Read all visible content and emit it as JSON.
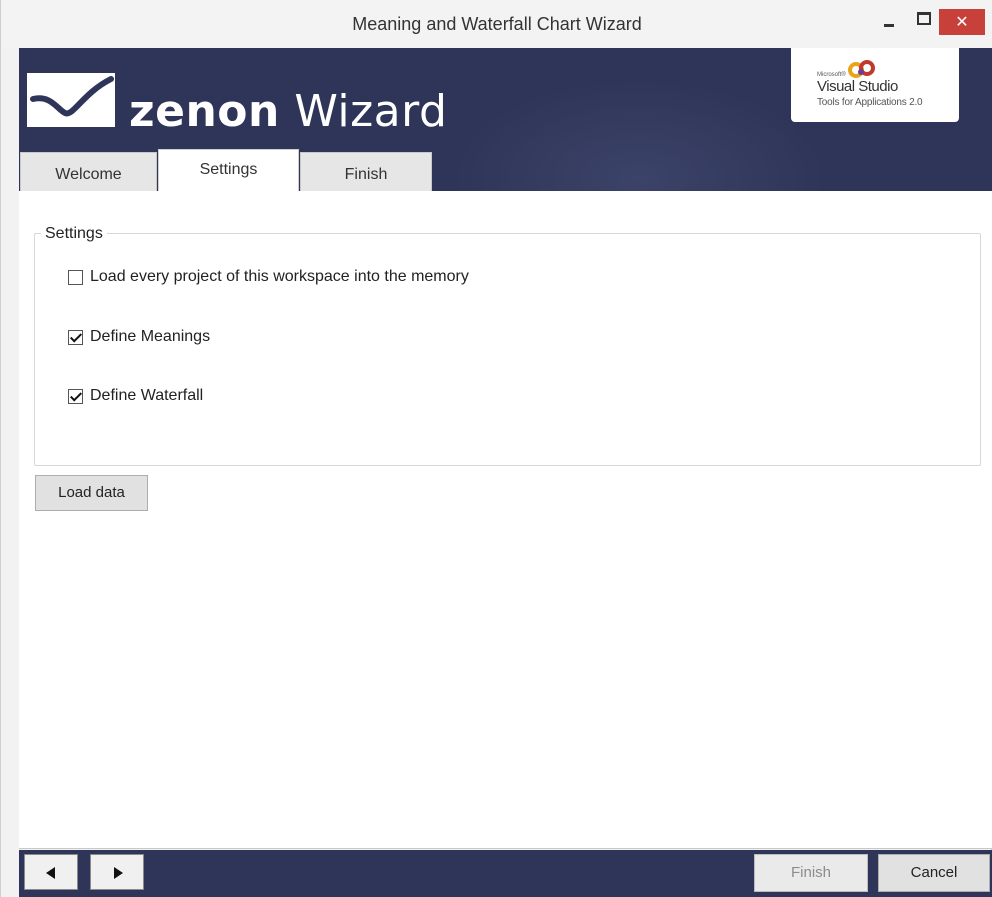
{
  "window": {
    "title": "Meaning and Waterfall Chart Wizard",
    "close_glyph": "✕"
  },
  "banner": {
    "brand_bold": "zenon",
    "brand_rest": " Wizard",
    "vs_microsoft": "Microsoft®",
    "vs_name": "Visual Studio",
    "vs_sub": "Tools for Applications 2.0"
  },
  "tabs": [
    {
      "label": "Welcome",
      "active": false
    },
    {
      "label": "Settings",
      "active": true
    },
    {
      "label": "Finish",
      "active": false
    }
  ],
  "settings": {
    "group_title": "Settings",
    "options": [
      {
        "label": "Load every project of this workspace into the memory",
        "checked": false
      },
      {
        "label": "Define Meanings",
        "checked": true
      },
      {
        "label": "Define Waterfall",
        "checked": true
      }
    ],
    "load_button": "Load data"
  },
  "footer": {
    "back_icon": "triangle-left-icon",
    "next_icon": "triangle-right-icon",
    "finish_label": "Finish",
    "finish_enabled": false,
    "cancel_label": "Cancel"
  },
  "colors": {
    "banner_bg": "#2e3558",
    "close_red": "#c7413a"
  }
}
